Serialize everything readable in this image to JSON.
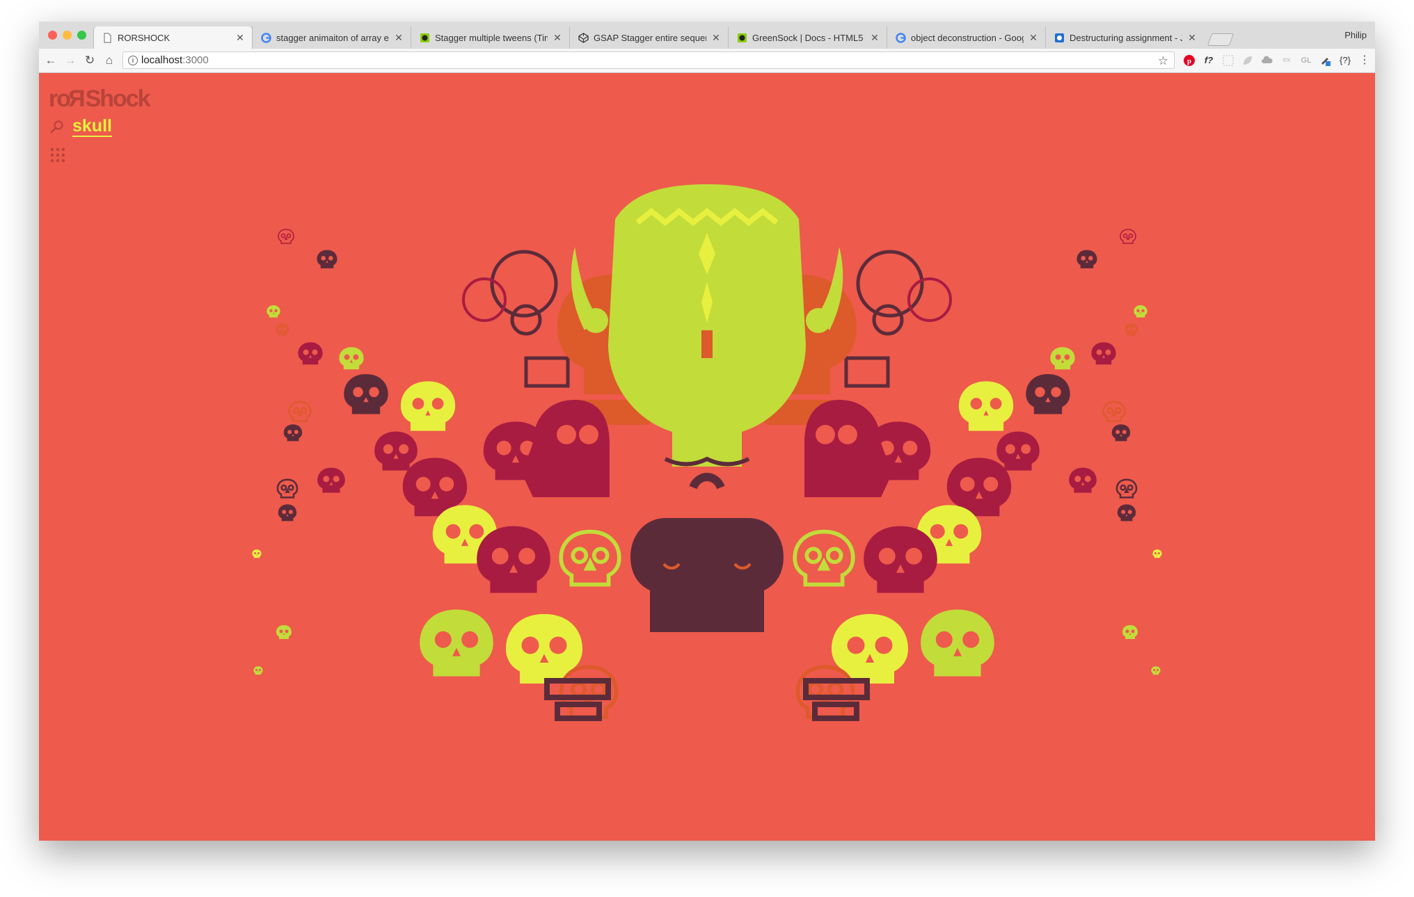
{
  "browser": {
    "tabs": [
      {
        "title": "RORSHOCK",
        "favicon": "page-icon",
        "active": true
      },
      {
        "title": "stagger animaiton of array elem",
        "favicon": "google-icon",
        "active": false
      },
      {
        "title": "Stagger multiple tweens (Timeli",
        "favicon": "greensock-icon",
        "active": false
      },
      {
        "title": "GSAP Stagger entire sequence",
        "favicon": "codepen-icon",
        "active": false
      },
      {
        "title": "GreenSock | Docs - HTML5 Ani",
        "favicon": "greensock-icon",
        "active": false
      },
      {
        "title": "object deconstruction - Google",
        "favicon": "google-icon",
        "active": false
      },
      {
        "title": "Destructuring assignment - Java",
        "favicon": "mdn-icon",
        "active": false
      }
    ],
    "profile_name": "Philip",
    "url_host": "localhost",
    "url_port": ":3000",
    "extensions": [
      "pinterest-icon",
      "f?",
      "grid-ext-icon",
      "leaf-ext-icon",
      "cloud-ext-icon",
      "ex",
      "GL",
      "paint-ext-icon",
      "{?}",
      "menu-icon"
    ]
  },
  "app": {
    "logo_text": {
      "part1": "ro",
      "flipped": "R",
      "part2": "Shock"
    },
    "search_query": "skull"
  },
  "colors": {
    "background": "#ee5a4c",
    "lime": "#c2dc3a",
    "yellow": "#e7f03f",
    "orange": "#dd5a2b",
    "maroon": "#5c2b3a",
    "crimson": "#a81c42",
    "logo": "#b8433a"
  }
}
